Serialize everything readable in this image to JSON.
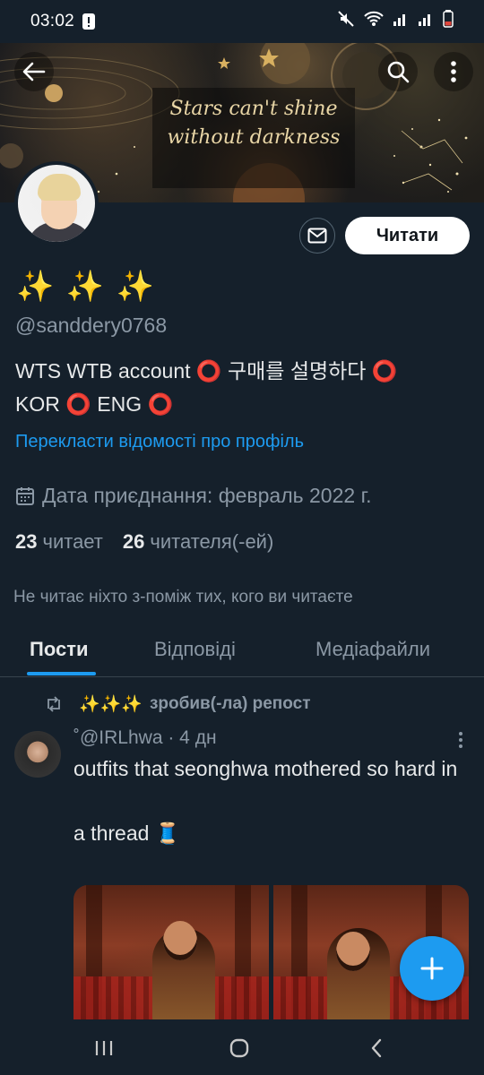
{
  "status_bar": {
    "time": "03:02"
  },
  "banner": {
    "quote_line1": "Stars can't shine",
    "quote_line2": "without darkness"
  },
  "profile": {
    "display_name": "✨ ✨ ✨",
    "handle": "@sanddery0768",
    "bio_line1": "WTS WTB account ⭕ 구매를 설명하다 ⭕",
    "bio_line2": "KOR ⭕ ENG ⭕",
    "translate_link": "Перекласти відомості про профіль",
    "join_date": "Дата приєднання: февраль 2022 г.",
    "following_count": "23",
    "following_label": "читает",
    "followers_count": "26",
    "followers_label": "читателя(-ей)",
    "followers_note": "Не читає ніхто з-поміж тих, кого ви читаєте",
    "follow_button": "Читати"
  },
  "tabs": [
    {
      "label": "Пости",
      "active": true
    },
    {
      "label": "Відповіді",
      "active": false
    },
    {
      "label": "Медіафайли",
      "active": false
    }
  ],
  "post": {
    "repost_by": "✨✨✨",
    "repost_text": "зробив(-ла) репост",
    "author_meta": "˚@IRLhwa · 4 дн",
    "text": "outfits that seonghwa mothered so hard in\n\na thread 🧵"
  },
  "colors": {
    "accent": "#1d9bf0",
    "background": "#15202b",
    "secondary_text": "#8b98a5"
  }
}
